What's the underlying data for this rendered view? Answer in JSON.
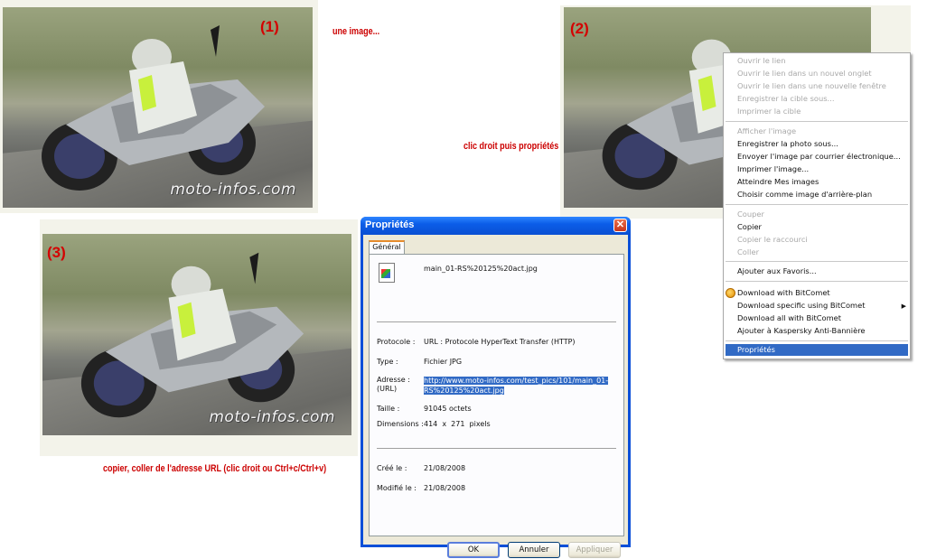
{
  "annotations": {
    "step1": "(1)",
    "step2": "(2)",
    "step3": "(3)",
    "une_image": "une image...",
    "clic_droit": "clic droit puis propriétés",
    "copier": "copier, coller de l'adresse URL (clic droit ou Ctrl+c/Ctrl+v)"
  },
  "photo": {
    "watermark": "moto-infos.com"
  },
  "context_menu": {
    "items": [
      {
        "label": "Ouvrir le lien",
        "disabled": true
      },
      {
        "label": "Ouvrir le lien dans un nouvel onglet",
        "disabled": true
      },
      {
        "label": "Ouvrir le lien dans une nouvelle fenêtre",
        "disabled": true
      },
      {
        "label": "Enregistrer la cible sous...",
        "disabled": true
      },
      {
        "label": "Imprimer la cible",
        "disabled": true
      },
      {
        "label": "Afficher l'image",
        "disabled": true
      },
      {
        "label": "Enregistrer la photo sous...",
        "disabled": false
      },
      {
        "label": "Envoyer l'image par courrier électronique...",
        "disabled": false
      },
      {
        "label": "Imprimer l'image...",
        "disabled": false
      },
      {
        "label": "Atteindre Mes images",
        "disabled": false
      },
      {
        "label": "Choisir comme image d'arrière-plan",
        "disabled": false
      },
      {
        "label": "Couper",
        "disabled": true
      },
      {
        "label": "Copier",
        "disabled": false
      },
      {
        "label": "Copier le raccourci",
        "disabled": true
      },
      {
        "label": "Coller",
        "disabled": true
      },
      {
        "label": "Ajouter aux Favoris...",
        "disabled": false
      },
      {
        "label": "Download with BitComet",
        "disabled": false
      },
      {
        "label": "Download specific using BitComet",
        "disabled": false
      },
      {
        "label": "Download all with BitComet",
        "disabled": false
      },
      {
        "label": "Ajouter à Kaspersky Anti-Bannière",
        "disabled": false
      },
      {
        "label": "Propriétés",
        "selected": true
      }
    ],
    "submenu_arrow": "▶"
  },
  "dialog": {
    "title": "Propriétés",
    "close": "✕",
    "tab": "Général",
    "filename": "main_01-RS%20125%20act.jpg",
    "rows": {
      "protocole_label": "Protocole :",
      "protocole_value": "URL : Protocole HyperText Transfer (HTTP)",
      "type_label": "Type :",
      "type_value": "Fichier JPG",
      "adresse_label": "Adresse :",
      "url_label": "(URL)",
      "adresse_value": "http://www.moto-infos.com/test_pics/101/main_01-RS%20125%20act.jpg",
      "taille_label": "Taille :",
      "taille_value": "91045 octets",
      "dimensions_label": "Dimensions :",
      "dimensions_value": "414  x  271  pixels",
      "cree_label": "Créé le :",
      "cree_value": "21/08/2008",
      "modifie_label": "Modifié le :",
      "modifie_value": "21/08/2008"
    },
    "buttons": {
      "ok": "OK",
      "annuler": "Annuler",
      "appliquer": "Appliquer"
    }
  },
  "colors": {
    "annotation_red": "#cc0000",
    "selection_blue": "#316ac5",
    "xp_title_blue": "#0a4fd2"
  }
}
